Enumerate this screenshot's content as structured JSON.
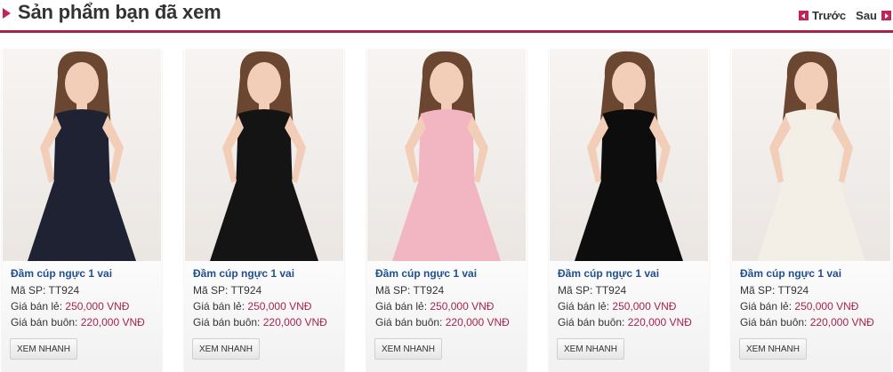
{
  "section": {
    "title": "Sản phẩm bạn đã xem",
    "prev_label": "Trước",
    "next_label": "Sau",
    "accent_color": "#a8234a"
  },
  "products": [
    {
      "name": "Đầm cúp ngực 1 vai",
      "sku_label": "Mã SP:",
      "sku": "TT924",
      "retail_label": "Giá bán lẻ:",
      "retail_price": "250,000 VNĐ",
      "wholesale_label": "Giá bán buôn:",
      "wholesale_price": "220,000 VNĐ",
      "quick_view": "XEM NHANH",
      "dress_color": "#1e2233"
    },
    {
      "name": "Đầm cúp ngực 1 vai",
      "sku_label": "Mã SP:",
      "sku": "TT924",
      "retail_label": "Giá bán lẻ:",
      "retail_price": "250,000 VNĐ",
      "wholesale_label": "Giá bán buôn:",
      "wholesale_price": "220,000 VNĐ",
      "quick_view": "XEM NHANH",
      "dress_color": "#141414"
    },
    {
      "name": "Đầm cúp ngực 1 vai",
      "sku_label": "Mã SP:",
      "sku": "TT924",
      "retail_label": "Giá bán lẻ:",
      "retail_price": "250,000 VNĐ",
      "wholesale_label": "Giá bán buôn:",
      "wholesale_price": "220,000 VNĐ",
      "quick_view": "XEM NHANH",
      "dress_color": "#f2b6c3"
    },
    {
      "name": "Đầm cúp ngực 1 vai",
      "sku_label": "Mã SP:",
      "sku": "TT924",
      "retail_label": "Giá bán lẻ:",
      "retail_price": "250,000 VNĐ",
      "wholesale_label": "Giá bán buôn:",
      "wholesale_price": "220,000 VNĐ",
      "quick_view": "XEM NHANH",
      "dress_color": "#0d0d0d"
    },
    {
      "name": "Đầm cúp ngực 1 vai",
      "sku_label": "Mã SP:",
      "sku": "TT924",
      "retail_label": "Giá bán lẻ:",
      "retail_price": "250,000 VNĐ",
      "wholesale_label": "Giá bán buôn:",
      "wholesale_price": "220,000 VNĐ",
      "quick_view": "XEM NHANH",
      "dress_color": "#f3eee6"
    }
  ]
}
